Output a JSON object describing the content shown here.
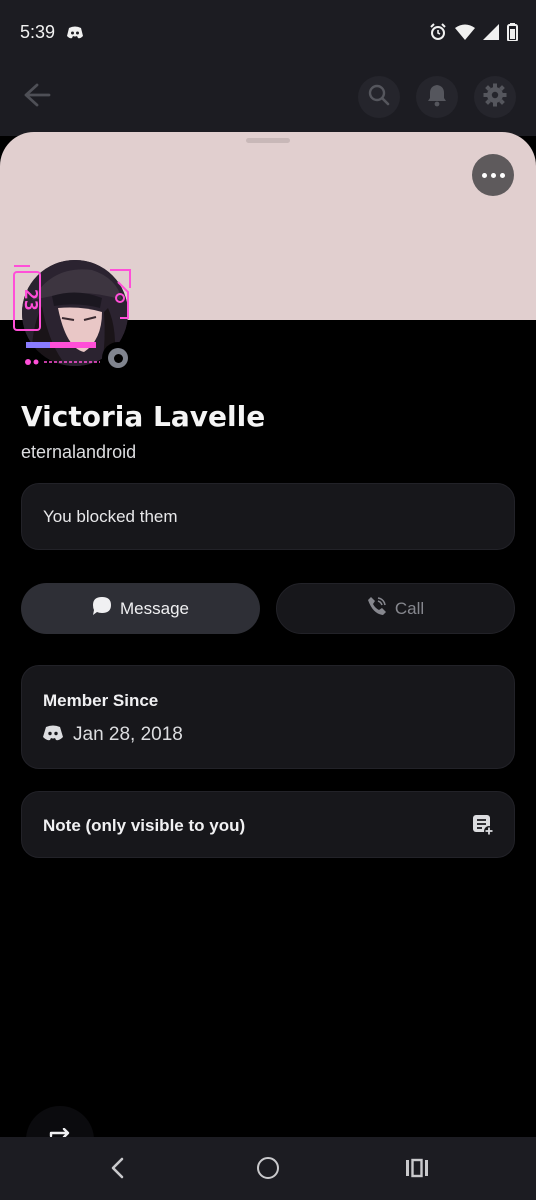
{
  "status_bar": {
    "time": "5:39",
    "icons": [
      "discord-notification-icon",
      "alarm-icon",
      "wifi-icon",
      "signal-icon",
      "battery-icon"
    ]
  },
  "app_bar": {
    "icons": [
      "back-arrow-icon",
      "search-icon",
      "bell-icon",
      "gear-icon"
    ]
  },
  "profile": {
    "banner_color": "#e1cfcf",
    "display_name": "Victoria Lavelle",
    "username": "eternalandroid",
    "blocked_text": "You blocked them",
    "status": "offline"
  },
  "actions": {
    "message_label": "Message",
    "call_label": "Call"
  },
  "member_since": {
    "label": "Member Since",
    "date": "Jan 28, 2018"
  },
  "note": {
    "label": "Note (only visible to you)"
  },
  "colors": {
    "background": "#000000",
    "card": "#17171b",
    "accent_pink": "#ff4fd8"
  }
}
